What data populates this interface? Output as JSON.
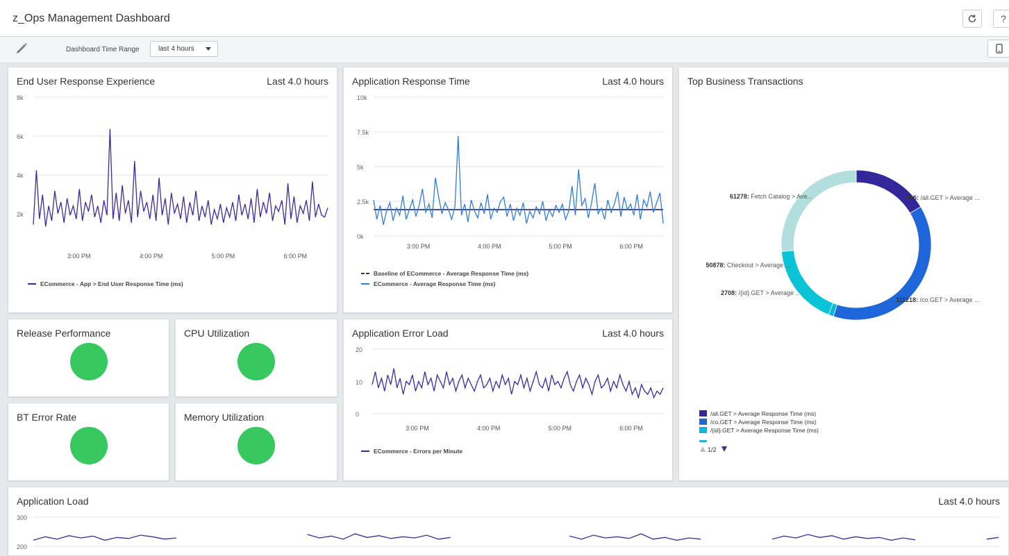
{
  "dashboard": {
    "title": "z_Ops Management Dashboard",
    "refresh_icon": "refresh-icon",
    "help_icon": "help-icon",
    "help_label": "?",
    "edit_icon": "pencil-icon",
    "mobile_icon": "mobile-device-icon"
  },
  "toolbar": {
    "time_range_label": "Dashboard Time Range",
    "time_range_value": "last 4 hours"
  },
  "colors": {
    "purple_series": "#3b2a9e",
    "blue_series": "#2f7be0",
    "baseline": "#2b2f8a",
    "status_ok": "#37c85f",
    "donut_1": "#34279a",
    "donut_2": "#1f66db",
    "donut_3": "#09b7d9",
    "donut_4": "#b2dfdd"
  },
  "panels": {
    "eure": {
      "title": "End User Response Experience",
      "range": "Last 4.0 hours"
    },
    "art": {
      "title": "Application Response Time",
      "range": "Last 4.0 hours"
    },
    "tbt": {
      "title": "Top Business Transactions"
    },
    "release": {
      "title": "Release Performance"
    },
    "cpu": {
      "title": "CPU Utilization"
    },
    "bterr": {
      "title": "BT Error Rate"
    },
    "mem": {
      "title": "Memory Utilization"
    },
    "ael": {
      "title": "Application Error Load",
      "range": "Last 4.0 hours"
    },
    "aload": {
      "title": "Application Load",
      "range": "Last 4.0 hours"
    }
  },
  "status": {
    "release": "ok",
    "cpu": "ok",
    "bterr": "ok",
    "mem": "ok"
  },
  "chart_data": [
    {
      "id": "eure",
      "type": "line",
      "title": "End User Response Experience",
      "y_ticks": [
        "8k",
        "6k",
        "4k",
        "2k"
      ],
      "ylim": [
        0,
        8000
      ],
      "x_ticks": [
        "3:00 PM",
        "4:00 PM",
        "5:00 PM",
        "6:00 PM"
      ],
      "x_tick_fractions": [
        0.155,
        0.4,
        0.645,
        0.89
      ],
      "grid": true,
      "series": [
        {
          "name": "ECommerce - App > End User Response Time (ms)",
          "color": "#3b2a9e",
          "values": [
            1200,
            4100,
            1500,
            2800,
            1100,
            2200,
            1400,
            3000,
            1800,
            2400,
            1300,
            2600,
            1700,
            2200,
            1500,
            3100,
            1400,
            2400,
            1900,
            2800,
            1600,
            2200,
            1300,
            2500,
            1700,
            6300,
            1500,
            2900,
            1400,
            3300,
            1800,
            2500,
            1300,
            4600,
            1600,
            3000,
            1900,
            2400,
            1500,
            2800,
            1400,
            3700,
            1700,
            2600,
            1200,
            2900,
            1800,
            2300,
            1500,
            2700,
            1300,
            2400,
            1700,
            3000,
            1400,
            2200,
            1600,
            2500,
            1200,
            2000,
            1500,
            2300,
            1300,
            2100,
            1600,
            2400,
            1400,
            2800,
            1700,
            2300,
            1500,
            2600,
            1300,
            3100,
            1600,
            2400,
            1800,
            2900,
            1400,
            2200,
            1900,
            2500,
            1200,
            3400,
            1500,
            2700,
            1300,
            2200,
            1800,
            2500,
            1400,
            3500,
            1600,
            2300,
            1700,
            1600,
            2100
          ]
        }
      ]
    },
    {
      "id": "art",
      "type": "line",
      "title": "Application Response Time",
      "y_ticks": [
        "10k",
        "7.5k",
        "5k",
        "2.5k",
        "0k"
      ],
      "ylim": [
        0,
        10000
      ],
      "x_ticks": [
        "3:00 PM",
        "4:00 PM",
        "5:00 PM",
        "6:00 PM"
      ],
      "x_tick_fractions": [
        0.155,
        0.4,
        0.645,
        0.89
      ],
      "grid": true,
      "series": [
        {
          "name": "Baseline of ECommerce - Average Response Time (ms)",
          "color": "#2b2f8a",
          "dashed": true,
          "values": [
            1900,
            1900,
            1900,
            1900,
            1900,
            1900,
            1900,
            1900,
            1900,
            1900
          ]
        },
        {
          "name": "ECommerce - Average Response Time (ms)",
          "color": "#2f7be0",
          "values": [
            2600,
            1200,
            2200,
            800,
            1800,
            2400,
            1100,
            2000,
            1500,
            2900,
            1200,
            1900,
            2600,
            1400,
            2200,
            3400,
            1700,
            2300,
            1300,
            4200,
            2800,
            1600,
            2400,
            1900,
            1200,
            2100,
            7200,
            1500,
            2300,
            1000,
            2600,
            1800,
            1300,
            2400,
            1600,
            3000,
            1200,
            2000,
            1700,
            2500,
            2800,
            1400,
            2300,
            1100,
            2000,
            1500,
            2400,
            900,
            1800,
            1300,
            2100,
            1600,
            2500,
            1100,
            1900,
            1400,
            2200,
            1700,
            2300,
            1200,
            1800,
            3600,
            1500,
            4800,
            2200,
            2700,
            1300,
            2400,
            3800,
            1600,
            2000,
            1200,
            2600,
            1700,
            2300,
            3200,
            1400,
            2800,
            1900,
            2300,
            1500,
            3000,
            1200,
            2600,
            2100,
            3200,
            1700,
            2400,
            3100,
            900
          ]
        }
      ]
    },
    {
      "id": "ael",
      "type": "line",
      "title": "Application Error Load",
      "y_ticks": [
        "20",
        "10",
        "0"
      ],
      "ylim": [
        0,
        20
      ],
      "x_ticks": [
        "3:00 PM",
        "4:00 PM",
        "5:00 PM",
        "6:00 PM"
      ],
      "x_tick_fractions": [
        0.155,
        0.4,
        0.645,
        0.89
      ],
      "grid": true,
      "series": [
        {
          "name": "ECommerce - Errors per Minute",
          "color": "#3b2a9e",
          "values": [
            9,
            13,
            8,
            11,
            7,
            12,
            9,
            14,
            8,
            11,
            6,
            10,
            9,
            12,
            7,
            10,
            8,
            13,
            9,
            11,
            7,
            12,
            10,
            8,
            13,
            9,
            11,
            7,
            10,
            12,
            8,
            11,
            9,
            7,
            10,
            12,
            8,
            9,
            11,
            7,
            10,
            8,
            12,
            9,
            11,
            6,
            10,
            9,
            12,
            8,
            11,
            7,
            10,
            13,
            9,
            8,
            11,
            7,
            12,
            9,
            10,
            8,
            11,
            13,
            9,
            7,
            10,
            12,
            8,
            11,
            9,
            6,
            10,
            12,
            8,
            9,
            11,
            7,
            10,
            8,
            12,
            9,
            7,
            10,
            6,
            8,
            5,
            9,
            7,
            6,
            8,
            5,
            7,
            6,
            8
          ]
        }
      ]
    },
    {
      "id": "aload",
      "type": "line",
      "title": "Application Load",
      "y_ticks": [
        "300",
        "200"
      ],
      "ylim": [
        0,
        300
      ],
      "grid": true,
      "series": [
        {
          "name": "Application Load",
          "color": "#3b2a9e",
          "values": [
            200,
            215,
            205,
            220,
            210,
            218,
            200,
            212,
            208,
            222,
            215,
            205,
            210,
            null,
            null,
            null,
            null,
            null,
            null,
            null,
            null,
            null,
            null,
            225,
            210,
            218,
            205,
            228,
            212,
            220,
            208,
            215,
            210,
            222,
            205,
            212,
            null,
            null,
            null,
            null,
            null,
            null,
            null,
            null,
            null,
            218,
            205,
            222,
            210,
            215,
            208,
            228,
            205,
            212,
            200,
            210,
            205,
            null,
            null,
            null,
            null,
            null,
            205,
            218,
            210,
            225,
            212,
            220,
            205,
            215,
            208,
            212,
            200,
            210,
            202,
            null,
            null,
            null,
            null,
            null,
            205,
            212
          ]
        }
      ]
    },
    {
      "id": "tbt",
      "type": "pie",
      "title": "Top Business Transactions",
      "donut": true,
      "slices": [
        {
          "label": "995: /all.GET > Average ...",
          "value": 15,
          "color": "#34279a"
        },
        {
          "label": "111218: /co.GET > Average ...",
          "value": 35,
          "color": "#1f66db"
        },
        {
          "label": "2708: /{id}.GET > Average ...",
          "value": 1,
          "color": "#09b7d9"
        },
        {
          "label": "50878: Checkout > Average ...",
          "value": 16,
          "color": "#09c4d6"
        },
        {
          "label": "61278: Fetch Catalog > Ave...",
          "value": 24,
          "color": "#b2dfdd"
        }
      ],
      "legend": [
        {
          "label": "/all.GET > Average Response Time (ms)",
          "color": "#34279a"
        },
        {
          "label": "/co.GET > Average Response Time (ms)",
          "color": "#1f66db"
        },
        {
          "label": "/{id}.GET > Average Response Time (ms)",
          "color": "#09b7d9"
        }
      ],
      "legend_page": "1/2"
    }
  ]
}
